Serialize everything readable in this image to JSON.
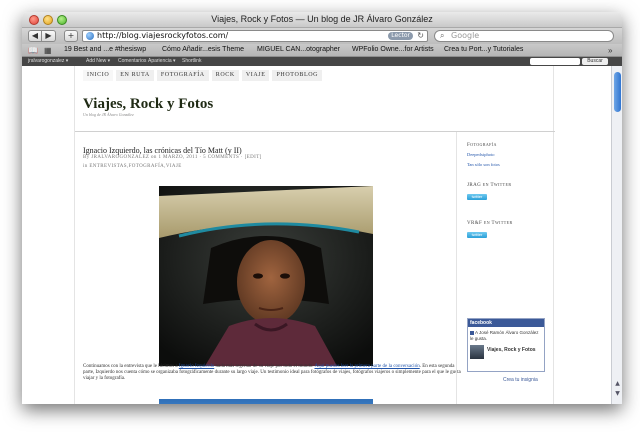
{
  "window": {
    "title": "Viajes, Rock y Fotos — Un blog de JR Álvaro González"
  },
  "toolbar": {
    "url": "http://blog.viajesrockyfotos.com/",
    "reader_label": "Lector",
    "search_placeholder": "Google",
    "back": "◀",
    "forward": "▶",
    "add": "+"
  },
  "bookmarks": [
    "19 Best and ...e #thesiswp",
    "Cómo Añadir...esis Theme",
    "MIGUEL CAN...otographer",
    "WPFolio Owne...for Artists",
    "Crea tu Port...y Tutoriales"
  ],
  "adminbar": {
    "items": [
      "jralvarogonzalez ▾",
      "Add New ▾",
      "Comentarios",
      "Apariencia ▾",
      "Shortlink"
    ],
    "search_button": "Buscar"
  },
  "nav": {
    "items": [
      "INICIO",
      "EN RUTA",
      "FOTOGRAFÍA",
      "ROCK",
      "VIAJE",
      "PHOTOBLOG"
    ]
  },
  "site": {
    "title": "Viajes, Rock y Fotos",
    "tagline": "Un blog de JR Álvaro González"
  },
  "post": {
    "title": "Ignacio Izquierdo, las crónicas del Tío Matt (y II)",
    "meta1": "By JRALVAROGONZALEZ on 1 MARZO, 2011 · 5 COMMENTS · [EDIT]",
    "meta2": "in ENTREVISTAS,FOTOGRAFÍA,VIAJE",
    "para_start": "Continuamos con la entrevista que le hicimos a ",
    "link1": "Ignacio Izquierdo",
    "para_mid": " nada más regresar de su viaje por todo el mundo. ",
    "link2": "Aquí puedes leer la primera parte de la conversación",
    "para_end": ". En esta segunda parte, Izquierdo nos cuenta cómo se organizaba fotográficamente durante su largo viaje. Un testimonio ideal para fotógrafos de viajes, fotógrafos viajeros o simplemente para el que le gusta viajar y la fotografía."
  },
  "sidebar": {
    "foto_heading": "Fotografía",
    "foto_links": [
      "Deepedxiphoto",
      "Tan sólo son fotos"
    ],
    "jrag_heading": "JRAG en Twitter",
    "vrf_heading": "VR&F en Twitter",
    "twitter_label": "twitter",
    "facebook": {
      "header": "facebook",
      "text": "A José Ramón Álvaro González le gusta.",
      "page": "Viajes, Rock y Fotos",
      "create": "Crea tu insignia"
    }
  }
}
